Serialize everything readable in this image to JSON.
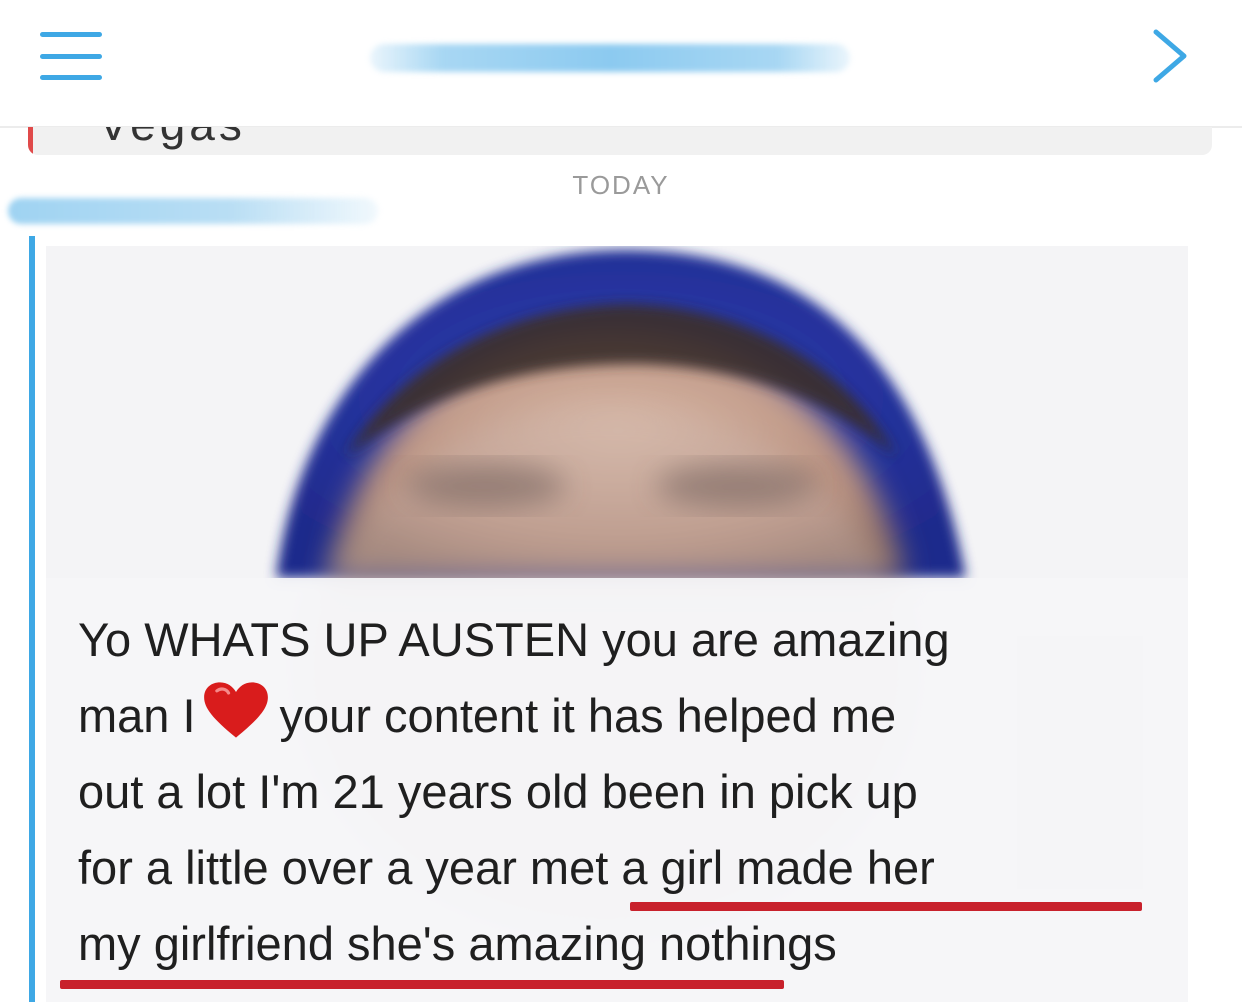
{
  "header": {
    "menu_icon": "hamburger-menu-icon",
    "title_redacted": true,
    "next_icon": "chevron-right-icon",
    "accent": "#3ea8e5"
  },
  "previous_message": {
    "text": "Vegas",
    "bar_color": "#e04a4a"
  },
  "date_separator": "TODAY",
  "message": {
    "sender_redacted": true,
    "bar_color": "#3ea8e5",
    "caption_lines": {
      "l1": "Yo WHATS UP AUSTEN you are amazing",
      "l2a": "man I",
      "l2_icon": "red-heart-emoji",
      "l2b": "your content it has helped me",
      "l3": "out a lot I'm 21 years old been in pick up",
      "l4": "for a little over a year met a girl made her",
      "l5": "my girlfriend she's amazing nothings"
    },
    "underline_color": "#c8212c"
  }
}
